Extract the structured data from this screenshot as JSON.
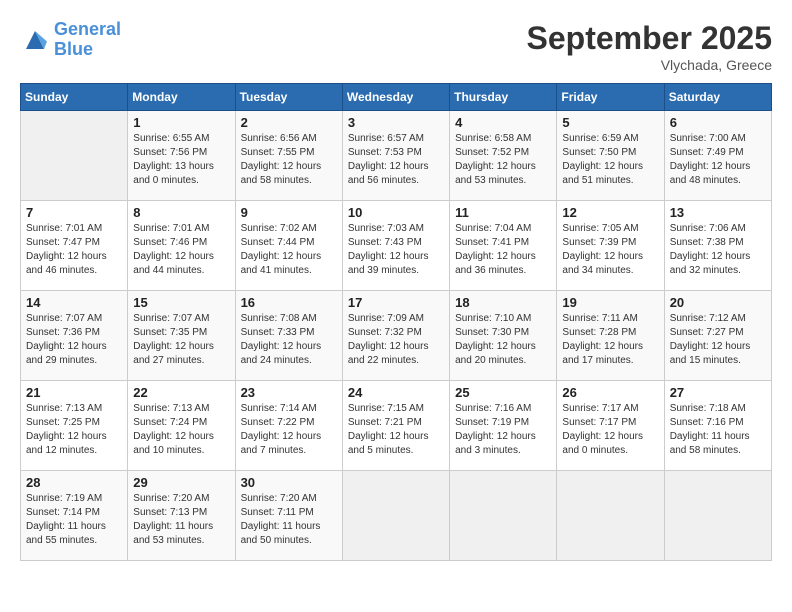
{
  "logo": {
    "line1": "General",
    "line2": "Blue"
  },
  "title": "September 2025",
  "location": "Vlychada, Greece",
  "days_of_week": [
    "Sunday",
    "Monday",
    "Tuesday",
    "Wednesday",
    "Thursday",
    "Friday",
    "Saturday"
  ],
  "weeks": [
    [
      {
        "day": "",
        "sunrise": "",
        "sunset": "",
        "daylight": ""
      },
      {
        "day": "1",
        "sunrise": "Sunrise: 6:55 AM",
        "sunset": "Sunset: 7:56 PM",
        "daylight": "Daylight: 13 hours and 0 minutes."
      },
      {
        "day": "2",
        "sunrise": "Sunrise: 6:56 AM",
        "sunset": "Sunset: 7:55 PM",
        "daylight": "Daylight: 12 hours and 58 minutes."
      },
      {
        "day": "3",
        "sunrise": "Sunrise: 6:57 AM",
        "sunset": "Sunset: 7:53 PM",
        "daylight": "Daylight: 12 hours and 56 minutes."
      },
      {
        "day": "4",
        "sunrise": "Sunrise: 6:58 AM",
        "sunset": "Sunset: 7:52 PM",
        "daylight": "Daylight: 12 hours and 53 minutes."
      },
      {
        "day": "5",
        "sunrise": "Sunrise: 6:59 AM",
        "sunset": "Sunset: 7:50 PM",
        "daylight": "Daylight: 12 hours and 51 minutes."
      },
      {
        "day": "6",
        "sunrise": "Sunrise: 7:00 AM",
        "sunset": "Sunset: 7:49 PM",
        "daylight": "Daylight: 12 hours and 48 minutes."
      }
    ],
    [
      {
        "day": "7",
        "sunrise": "Sunrise: 7:01 AM",
        "sunset": "Sunset: 7:47 PM",
        "daylight": "Daylight: 12 hours and 46 minutes."
      },
      {
        "day": "8",
        "sunrise": "Sunrise: 7:01 AM",
        "sunset": "Sunset: 7:46 PM",
        "daylight": "Daylight: 12 hours and 44 minutes."
      },
      {
        "day": "9",
        "sunrise": "Sunrise: 7:02 AM",
        "sunset": "Sunset: 7:44 PM",
        "daylight": "Daylight: 12 hours and 41 minutes."
      },
      {
        "day": "10",
        "sunrise": "Sunrise: 7:03 AM",
        "sunset": "Sunset: 7:43 PM",
        "daylight": "Daylight: 12 hours and 39 minutes."
      },
      {
        "day": "11",
        "sunrise": "Sunrise: 7:04 AM",
        "sunset": "Sunset: 7:41 PM",
        "daylight": "Daylight: 12 hours and 36 minutes."
      },
      {
        "day": "12",
        "sunrise": "Sunrise: 7:05 AM",
        "sunset": "Sunset: 7:39 PM",
        "daylight": "Daylight: 12 hours and 34 minutes."
      },
      {
        "day": "13",
        "sunrise": "Sunrise: 7:06 AM",
        "sunset": "Sunset: 7:38 PM",
        "daylight": "Daylight: 12 hours and 32 minutes."
      }
    ],
    [
      {
        "day": "14",
        "sunrise": "Sunrise: 7:07 AM",
        "sunset": "Sunset: 7:36 PM",
        "daylight": "Daylight: 12 hours and 29 minutes."
      },
      {
        "day": "15",
        "sunrise": "Sunrise: 7:07 AM",
        "sunset": "Sunset: 7:35 PM",
        "daylight": "Daylight: 12 hours and 27 minutes."
      },
      {
        "day": "16",
        "sunrise": "Sunrise: 7:08 AM",
        "sunset": "Sunset: 7:33 PM",
        "daylight": "Daylight: 12 hours and 24 minutes."
      },
      {
        "day": "17",
        "sunrise": "Sunrise: 7:09 AM",
        "sunset": "Sunset: 7:32 PM",
        "daylight": "Daylight: 12 hours and 22 minutes."
      },
      {
        "day": "18",
        "sunrise": "Sunrise: 7:10 AM",
        "sunset": "Sunset: 7:30 PM",
        "daylight": "Daylight: 12 hours and 20 minutes."
      },
      {
        "day": "19",
        "sunrise": "Sunrise: 7:11 AM",
        "sunset": "Sunset: 7:28 PM",
        "daylight": "Daylight: 12 hours and 17 minutes."
      },
      {
        "day": "20",
        "sunrise": "Sunrise: 7:12 AM",
        "sunset": "Sunset: 7:27 PM",
        "daylight": "Daylight: 12 hours and 15 minutes."
      }
    ],
    [
      {
        "day": "21",
        "sunrise": "Sunrise: 7:13 AM",
        "sunset": "Sunset: 7:25 PM",
        "daylight": "Daylight: 12 hours and 12 minutes."
      },
      {
        "day": "22",
        "sunrise": "Sunrise: 7:13 AM",
        "sunset": "Sunset: 7:24 PM",
        "daylight": "Daylight: 12 hours and 10 minutes."
      },
      {
        "day": "23",
        "sunrise": "Sunrise: 7:14 AM",
        "sunset": "Sunset: 7:22 PM",
        "daylight": "Daylight: 12 hours and 7 minutes."
      },
      {
        "day": "24",
        "sunrise": "Sunrise: 7:15 AM",
        "sunset": "Sunset: 7:21 PM",
        "daylight": "Daylight: 12 hours and 5 minutes."
      },
      {
        "day": "25",
        "sunrise": "Sunrise: 7:16 AM",
        "sunset": "Sunset: 7:19 PM",
        "daylight": "Daylight: 12 hours and 3 minutes."
      },
      {
        "day": "26",
        "sunrise": "Sunrise: 7:17 AM",
        "sunset": "Sunset: 7:17 PM",
        "daylight": "Daylight: 12 hours and 0 minutes."
      },
      {
        "day": "27",
        "sunrise": "Sunrise: 7:18 AM",
        "sunset": "Sunset: 7:16 PM",
        "daylight": "Daylight: 11 hours and 58 minutes."
      }
    ],
    [
      {
        "day": "28",
        "sunrise": "Sunrise: 7:19 AM",
        "sunset": "Sunset: 7:14 PM",
        "daylight": "Daylight: 11 hours and 55 minutes."
      },
      {
        "day": "29",
        "sunrise": "Sunrise: 7:20 AM",
        "sunset": "Sunset: 7:13 PM",
        "daylight": "Daylight: 11 hours and 53 minutes."
      },
      {
        "day": "30",
        "sunrise": "Sunrise: 7:20 AM",
        "sunset": "Sunset: 7:11 PM",
        "daylight": "Daylight: 11 hours and 50 minutes."
      },
      {
        "day": "",
        "sunrise": "",
        "sunset": "",
        "daylight": ""
      },
      {
        "day": "",
        "sunrise": "",
        "sunset": "",
        "daylight": ""
      },
      {
        "day": "",
        "sunrise": "",
        "sunset": "",
        "daylight": ""
      },
      {
        "day": "",
        "sunrise": "",
        "sunset": "",
        "daylight": ""
      }
    ]
  ]
}
